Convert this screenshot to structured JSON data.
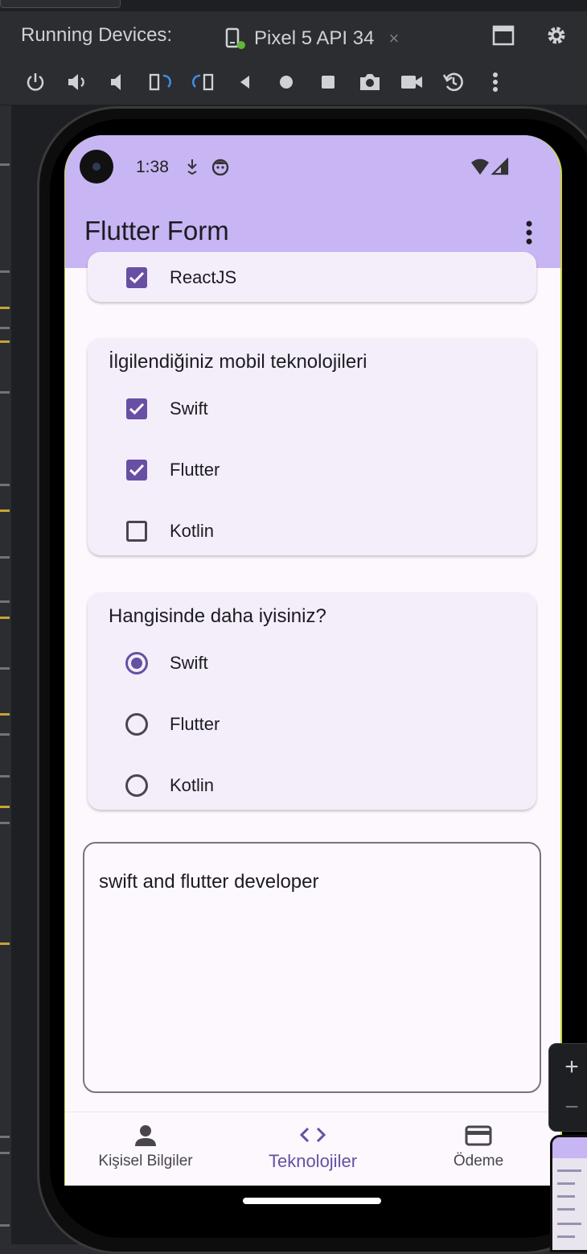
{
  "ide": {
    "running_devices_label": "Running Devices:",
    "device_tab": "Pixel 5 API 34",
    "close_glyph": "×",
    "toolbar_icons": [
      "power-icon",
      "volume-up-icon",
      "volume-down-icon",
      "rotate-left-icon",
      "rotate-right-icon",
      "back-icon",
      "home-icon",
      "overview-icon",
      "screenshot-icon",
      "screen-record-icon",
      "reset-icon",
      "more-vert-icon"
    ],
    "zoom_in": "+",
    "zoom_out": "−"
  },
  "status_bar": {
    "time": "1:38"
  },
  "app_bar": {
    "title": "Flutter Form"
  },
  "cards": {
    "web": {
      "items": [
        {
          "label": "ReactJS",
          "checked": true
        }
      ]
    },
    "mobile": {
      "title": "İlgilendiğiniz mobil teknolojileri",
      "items": [
        {
          "label": "Swift",
          "checked": true
        },
        {
          "label": "Flutter",
          "checked": true
        },
        {
          "label": "Kotlin",
          "checked": false
        }
      ]
    },
    "best": {
      "title": "Hangisinde daha iyisiniz?",
      "options": [
        {
          "label": "Swift",
          "selected": true
        },
        {
          "label": "Flutter",
          "selected": false
        },
        {
          "label": "Kotlin",
          "selected": false
        }
      ]
    }
  },
  "notes": {
    "value": "swift and flutter developer"
  },
  "bottom_nav": {
    "items": [
      {
        "label": "Kişisel Bilgiler",
        "icon": "person-icon"
      },
      {
        "label": "Teknolojiler",
        "icon": "code-icon",
        "active": true
      },
      {
        "label": "Ödeme",
        "icon": "credit-card-icon"
      }
    ]
  },
  "colors": {
    "primary": "#6750a4",
    "app_bar": "#c8b5f4",
    "surface": "#fdf8fd",
    "card": "#f4eefa"
  }
}
